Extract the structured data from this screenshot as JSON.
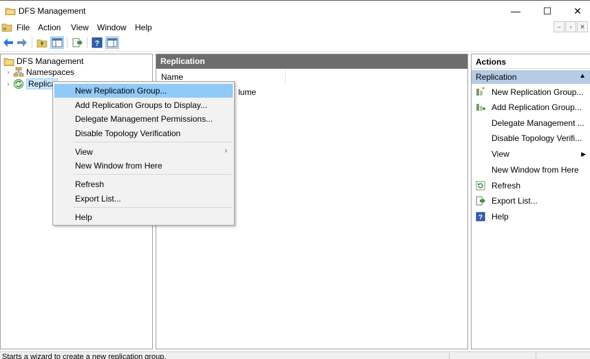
{
  "window": {
    "title": "DFS Management",
    "icon": "dfs-management-icon",
    "controls": {
      "minimize": "—",
      "maximize": "☐",
      "close": "✕"
    }
  },
  "menubar": {
    "items": [
      "File",
      "Action",
      "View",
      "Window",
      "Help"
    ],
    "mdi_controls": [
      "–",
      "▫",
      "✕"
    ]
  },
  "toolbar": {
    "buttons": [
      "back-icon",
      "forward-icon",
      "up-folder-icon",
      "show-hide-tree-icon",
      "export-list-icon",
      "help-icon",
      "show-hide-action-pane-icon"
    ]
  },
  "tree": {
    "root": "DFS Management",
    "items": [
      {
        "label": "Namespaces",
        "icon": "namespaces-icon"
      },
      {
        "label": "Replica",
        "icon": "replication-icon"
      }
    ]
  },
  "center": {
    "header": "Replication",
    "column": "Name",
    "row_partial": "lume"
  },
  "actions": {
    "title": "Actions",
    "section": "Replication",
    "items": [
      {
        "label": "New Replication Group...",
        "icon": "new-replication-group-icon",
        "submenu": false
      },
      {
        "label": "Add Replication Group...",
        "icon": "add-replication-group-icon",
        "submenu": false
      },
      {
        "label": "Delegate Management ...",
        "icon": "",
        "submenu": false
      },
      {
        "label": "Disable Topology Verifi...",
        "icon": "",
        "submenu": false
      },
      {
        "label": "View",
        "icon": "",
        "submenu": true
      },
      {
        "label": "New Window from Here",
        "icon": "",
        "submenu": false
      },
      {
        "label": "Refresh",
        "icon": "refresh-icon",
        "submenu": false
      },
      {
        "label": "Export List...",
        "icon": "export-list-icon",
        "submenu": false
      },
      {
        "label": "Help",
        "icon": "help-icon",
        "submenu": false
      }
    ]
  },
  "context_menu": {
    "items": [
      {
        "label": "New Replication Group...",
        "highlighted": true
      },
      {
        "label": "Add Replication Groups to Display..."
      },
      {
        "label": "Delegate Management Permissions..."
      },
      {
        "label": "Disable Topology Verification"
      },
      {
        "label": "View",
        "submenu": true
      },
      {
        "label": "New Window from Here"
      },
      {
        "label": "Refresh"
      },
      {
        "label": "Export List..."
      },
      {
        "label": "Help"
      }
    ]
  },
  "statusbar": {
    "text": "Starts a wizard to create a new replication group."
  },
  "colors": {
    "pane_header": "#6d6d6d",
    "actions_section": "#b6cbe4",
    "menu_highlight": "#91c9f7",
    "tree_selection": "#cce8ff"
  }
}
